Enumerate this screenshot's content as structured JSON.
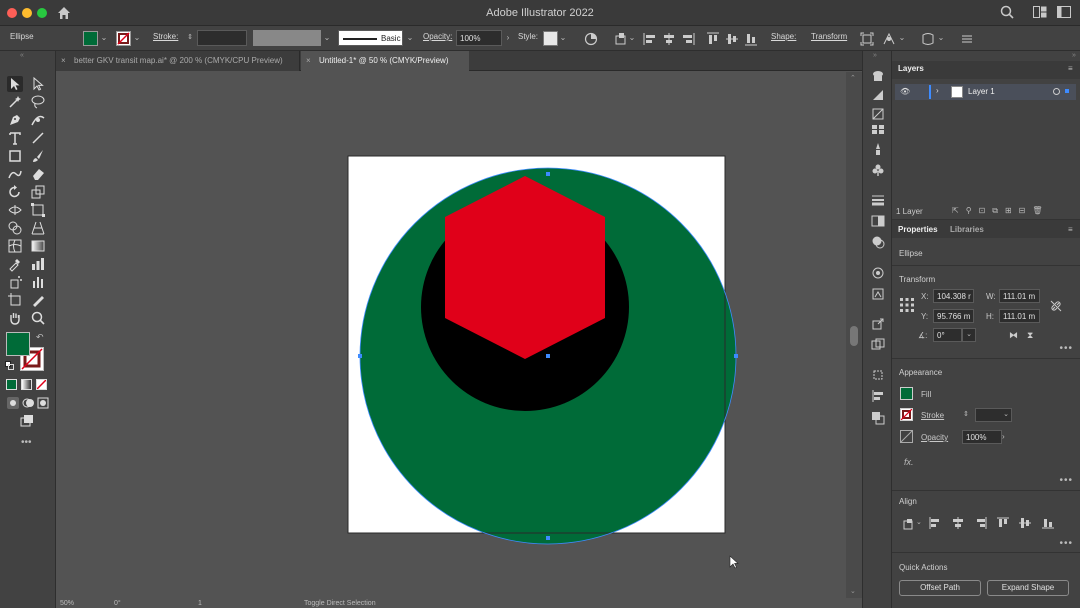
{
  "app": {
    "title": "Adobe Illustrator 2022"
  },
  "controlbar": {
    "selection_label": "Ellipse",
    "fill_color": "#006b38",
    "stroke_label": "Stroke:",
    "stroke_profile": "Basic",
    "opacity_label": "Opacity:",
    "opacity_value": "100%",
    "style_label": "Style:",
    "shape_label": "Shape:",
    "transform_label": "Transform"
  },
  "tabs": [
    {
      "label": "better GKV transit map.ai* @ 200 % (CMYK/CPU Preview)",
      "active": false
    },
    {
      "label": "Untitled-1* @ 50 % (CMYK/Preview)",
      "active": true
    }
  ],
  "artwork": {
    "outer_circle_color": "#006b38",
    "inner_circle_color": "#000000",
    "hexagon_color": "#e00019",
    "artboard_color": "#ffffff",
    "selection_color": "#3d8bff"
  },
  "toolbar": {
    "fill_swatch": "#006b38"
  },
  "panels": {
    "layers_tab": "Layers",
    "layer_name": "Layer 1",
    "layer_count": "1 Layer",
    "properties_tab": "Properties",
    "libraries_tab": "Libraries",
    "object_type": "Ellipse",
    "transform_title": "Transform",
    "x_label": "X:",
    "x_value": "104.308 r",
    "y_label": "Y:",
    "y_value": "95.766 m",
    "w_label": "W:",
    "w_value": "111.01 m",
    "h_label": "H:",
    "h_value": "111.01 m",
    "rotate_value": "0°",
    "appearance_title": "Appearance",
    "fill_label": "Fill",
    "stroke_label": "Stroke",
    "opacity_label": "Opacity",
    "opacity_value": "100%",
    "fx_label": "fx.",
    "align_title": "Align",
    "quick_actions_title": "Quick Actions",
    "offset_path_button": "Offset Path",
    "expand_shape_button": "Expand Shape"
  },
  "status": {
    "zoom": "50%",
    "angle": "0°",
    "page": "1",
    "tool": "Toggle Direct Selection"
  }
}
